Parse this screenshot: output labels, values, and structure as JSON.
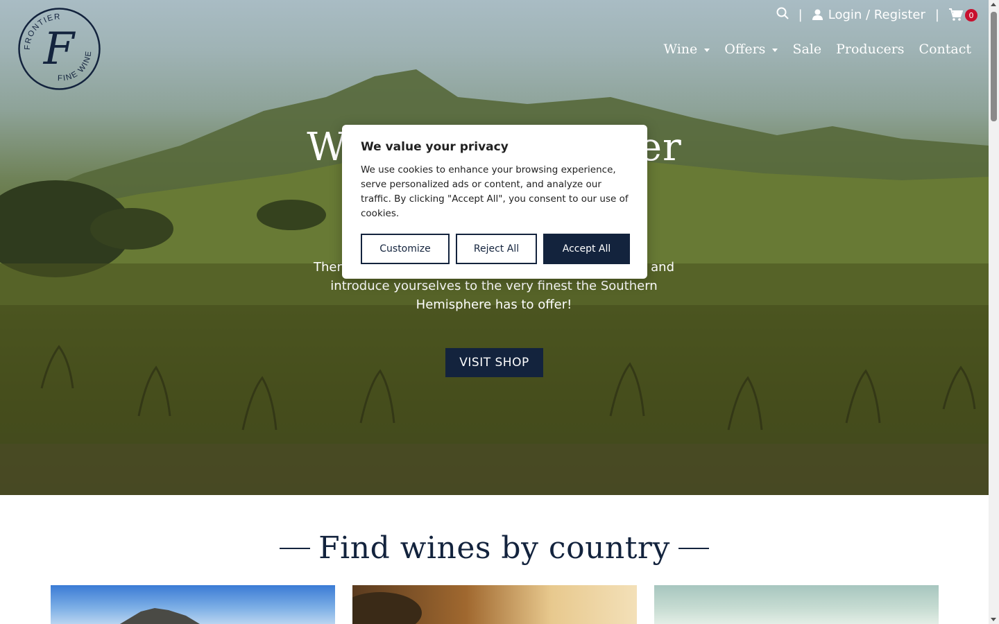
{
  "header": {
    "logo": {
      "text_top": "FRONTIER",
      "text_bottom": "FINE WINES",
      "monogram": "F"
    },
    "topbar": {
      "search_icon": "search-icon",
      "separator": "|",
      "login_label": "Login / Register",
      "cart_count": "0"
    },
    "nav": [
      {
        "label": "Wine",
        "has_dropdown": true
      },
      {
        "label": "Offers",
        "has_dropdown": true
      },
      {
        "label": "Sale",
        "has_dropdown": false
      },
      {
        "label": "Producers",
        "has_dropdown": false
      },
      {
        "label": "Contact",
        "has_dropdown": false
      }
    ]
  },
  "hero": {
    "title_left": "W",
    "title_right": "er",
    "text_line1_left": "Ther",
    "text_line1_right": "and",
    "text_line2": "introduce yourselves to the very finest the Southern",
    "text_line3": "Hemisphere has to offer!",
    "cta_label": "VISIT SHOP"
  },
  "cookie_banner": {
    "title": "We value your privacy",
    "body": "We use cookies to enhance your browsing experience, serve personalized ads or content, and analyze our traffic. By clicking \"Accept All\", you consent to our use of cookies.",
    "customize_label": "Customize",
    "reject_label": "Reject All",
    "accept_label": "Accept All"
  },
  "section": {
    "heading": "Find wines by country"
  },
  "colors": {
    "brand_navy": "#13233d",
    "cart_badge": "#c8102e"
  }
}
